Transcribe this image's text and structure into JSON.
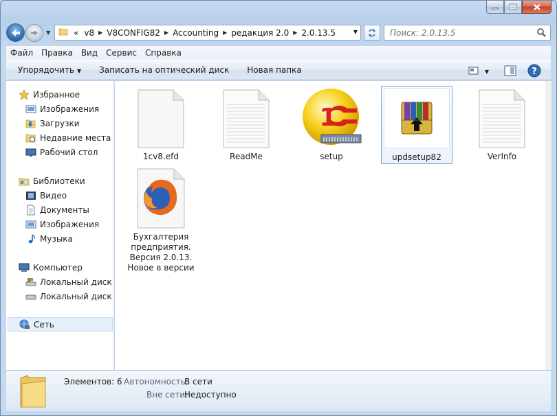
{
  "address": {
    "overflow": "«",
    "crumbs": [
      "v8",
      "V8CONFIG82",
      "Accounting",
      "редакция 2.0",
      "2.0.13.5"
    ]
  },
  "search": {
    "placeholder": "Поиск: 2.0.13.5"
  },
  "menu": [
    {
      "label": "Файл"
    },
    {
      "label": "Правка"
    },
    {
      "label": "Вид"
    },
    {
      "label": "Сервис"
    },
    {
      "label": "Справка"
    }
  ],
  "commands": {
    "organize": "Упорядочить",
    "burn": "Записать на оптический диск",
    "new_folder": "Новая папка"
  },
  "nav": {
    "favorites": "Избранное",
    "fav_items": [
      "Изображения",
      "Загрузки",
      "Недавние места",
      "Рабочий стол"
    ],
    "libraries": "Библиотеки",
    "lib_items": [
      "Видео",
      "Документы",
      "Изображения",
      "Музыка"
    ],
    "computer": "Компьютер",
    "comp_items": [
      "Локальный диск (C",
      "Локальный диск (D"
    ],
    "network": "Сеть"
  },
  "files": [
    {
      "name": "1cv8.efd",
      "icon": "blank-file-icon"
    },
    {
      "name": "ReadMe",
      "icon": "text-file-icon"
    },
    {
      "name": "setup",
      "icon": "1c-setup-icon"
    },
    {
      "name": "updsetup82",
      "icon": "winrar-archive-icon"
    },
    {
      "name": "VerInfo",
      "icon": "text-file-icon"
    },
    {
      "name": "Бухгалтерия предприятия. Версия 2.0.13. Новое в версии",
      "icon": "firefox-html-icon"
    }
  ],
  "details": {
    "count_label": "Элементов: 6",
    "offline_key": "Автономность:",
    "offline_val": "В сети",
    "outside_key": "Вне сети:",
    "outside_val": "Недоступно"
  },
  "colors": {
    "accent": "#2f6db6",
    "selection": "#e5f0fb",
    "close": "#c2412a"
  }
}
